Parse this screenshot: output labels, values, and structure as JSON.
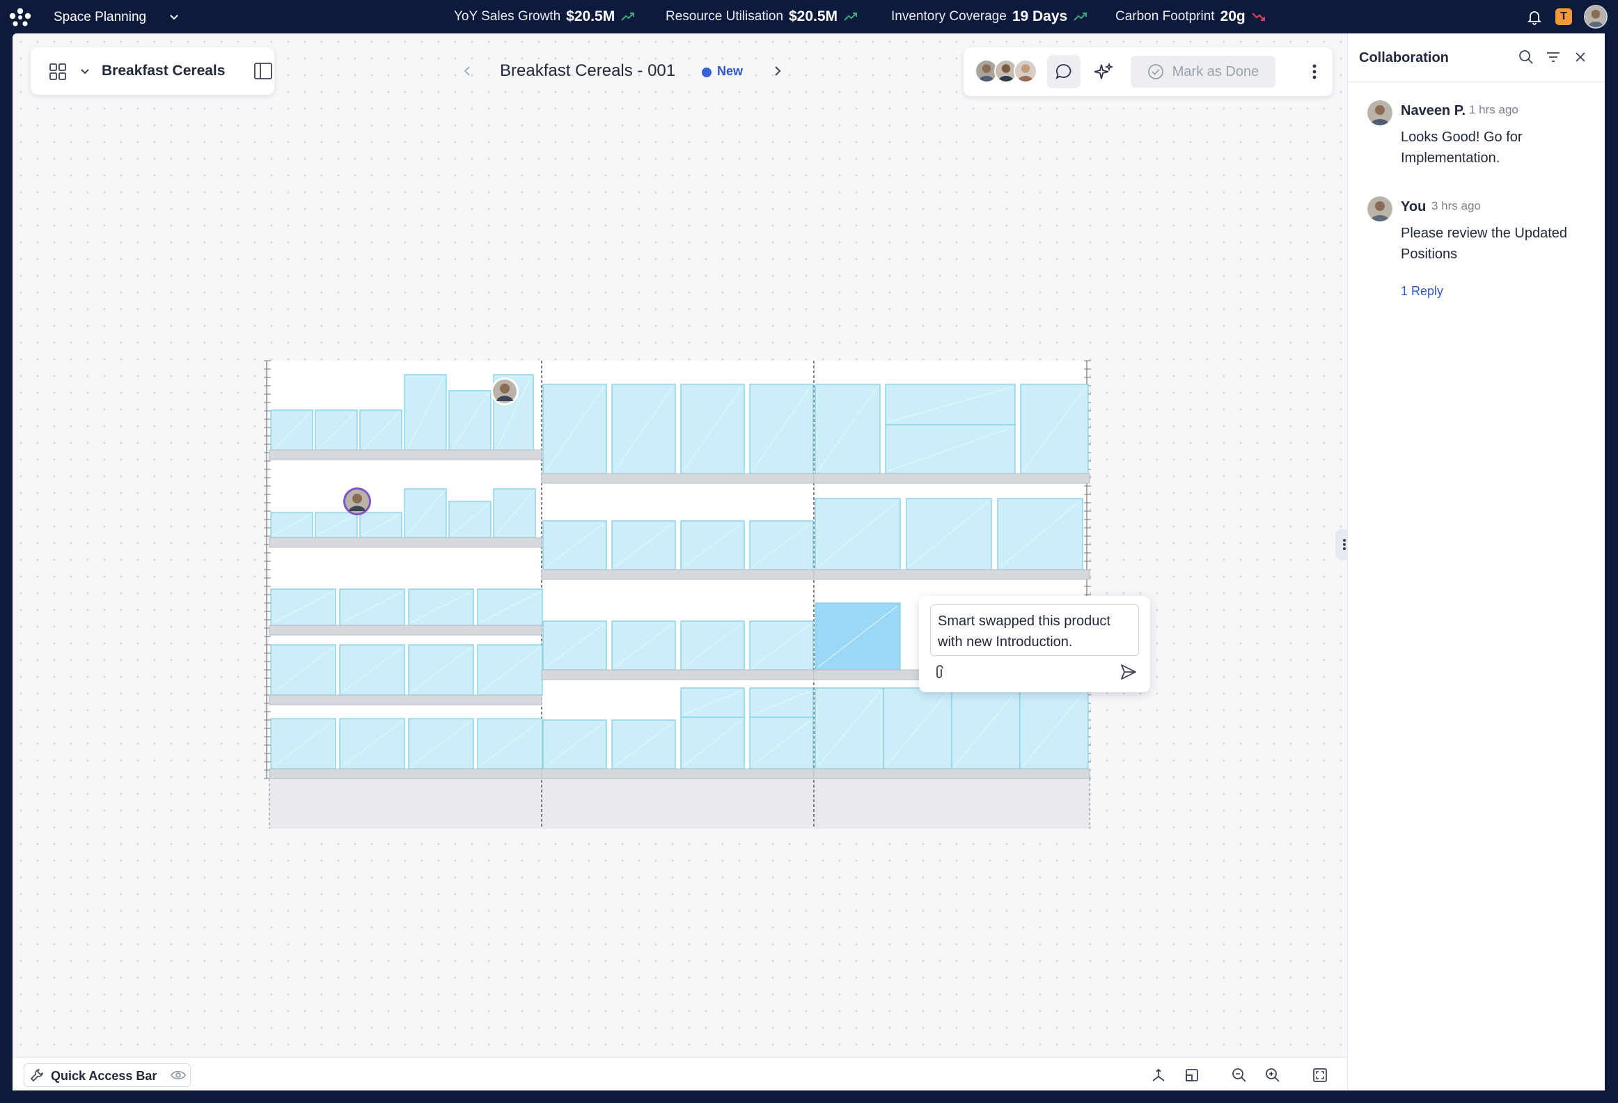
{
  "topbar": {
    "app_title": "Space Planning",
    "kpis": [
      {
        "label": "YoY Sales Growth",
        "value": "$20.5M",
        "trend": "up"
      },
      {
        "label": "Resource Utilisation",
        "value": "$20.5M",
        "trend": "up"
      },
      {
        "label": "Inventory Coverage",
        "value": "19 Days",
        "trend": "up"
      },
      {
        "label": "Carbon Footprint",
        "value": "20g",
        "trend": "down"
      }
    ],
    "badge": "T",
    "colors": {
      "up": "#3aa87a",
      "down": "#e0445a",
      "bg": "#0e1a3c"
    }
  },
  "toolbar": {
    "category": "Breakfast Cereals",
    "doc_title": "Breakfast Cereals - 001",
    "status": "New",
    "mark_done": "Mark as Done"
  },
  "popover": {
    "text": "Smart swapped this product with new Introduction."
  },
  "bottom": {
    "quick_access": "Quick Access Bar"
  },
  "collab": {
    "title": "Collaboration",
    "comments": [
      {
        "author": "Naveen P.",
        "time": "1 hrs ago",
        "body": "Looks Good! Go for Implementation."
      },
      {
        "author": "You",
        "time": "3 hrs ago",
        "body": "Please review the Updated Positions",
        "reply": "1 Reply"
      }
    ]
  },
  "planogram": {
    "product_fill": "#cdeef9",
    "product_stroke": "#86d2ea",
    "shelf_color": "#d5d8dd",
    "highlight_fill": "#9ad8f5"
  }
}
